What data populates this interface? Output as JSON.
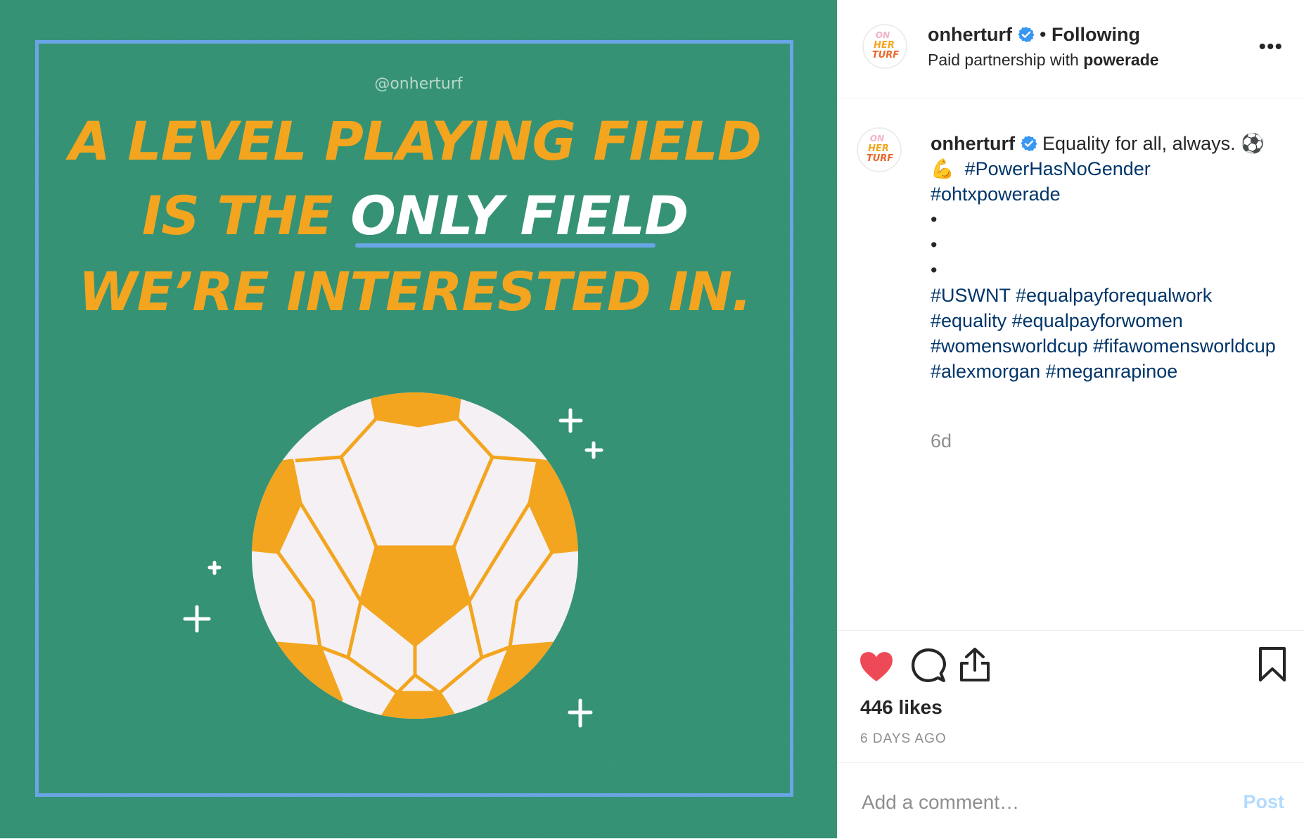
{
  "post_image": {
    "watermark": "@onherturf",
    "headline_line1": "A LEVEL PLAYING FIELD",
    "headline_line2_prefix": "IS THE",
    "headline_line2_highlight": "ONLY FIELD",
    "headline_line3": "WE’RE INTERESTED IN.",
    "colors": {
      "background": "#2e8f6f",
      "frame": "#6aa5e6",
      "headline": "#f3a51f",
      "ball_panel": "#f3a51f"
    }
  },
  "header": {
    "avatar_text": [
      "ON",
      "HER",
      "TURF"
    ],
    "username": "onherturf",
    "separator": "•",
    "follow_status": "Following",
    "partnership_prefix": "Paid partnership with",
    "partner": "powerade",
    "more_icon": "more-horizontal-icon"
  },
  "caption": {
    "username": "onherturf",
    "text": "Equality for all, always.",
    "emoji_ball": "⚽",
    "emoji_muscle": "💪",
    "tags_line1": [
      "#PowerHasNoGender"
    ],
    "tags_line2": [
      "#ohtxpowerade"
    ],
    "bullets": [
      "•",
      "•",
      "•"
    ],
    "tags_block": [
      "#USWNT",
      "#equalpayforequalwork",
      "#equality",
      "#equalpayforwomen",
      "#womensworldcup",
      "#fifawomensworldcup",
      "#alexmorgan",
      "#meganrapinoe"
    ],
    "age": "6d"
  },
  "actions": {
    "liked": true,
    "like_color": "#ed4956",
    "icons": [
      "heart-icon",
      "comment-icon",
      "share-icon",
      "bookmark-icon"
    ],
    "likes": "446 likes",
    "posted": "6 DAYS AGO"
  },
  "comment": {
    "placeholder": "Add a comment…",
    "post_label": "Post"
  }
}
